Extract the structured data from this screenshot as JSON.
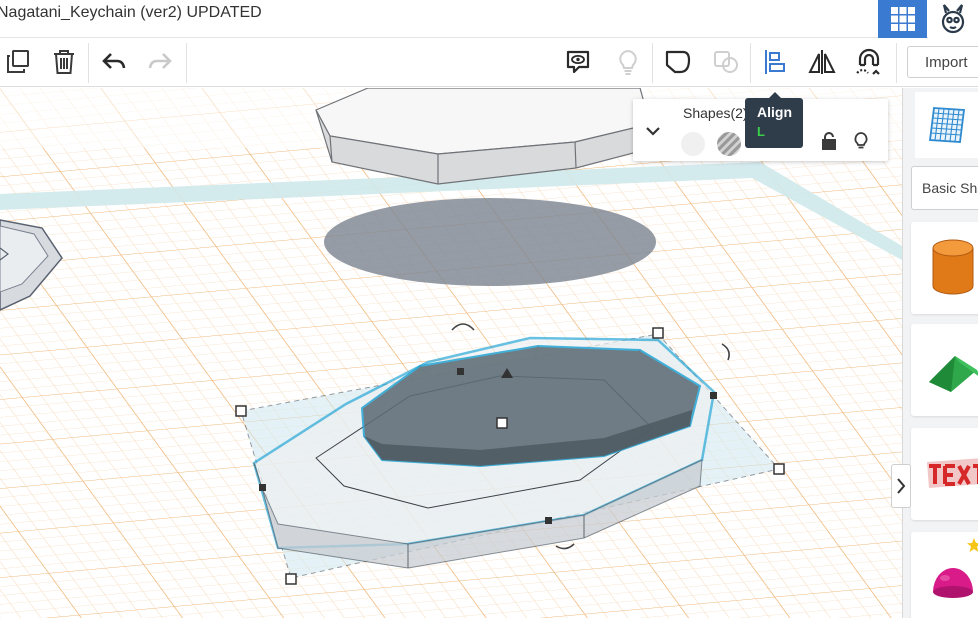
{
  "title_bar": {
    "project_title": "Nagatani_Keychain (ver2) UPDATED"
  },
  "toolbar": {
    "left_tools": [
      {
        "name": "copy-icon",
        "label": "Duplicate"
      },
      {
        "name": "trash-icon",
        "label": "Delete"
      },
      {
        "name": "undo-icon",
        "label": "Undo"
      },
      {
        "name": "redo-icon",
        "label": "Redo",
        "disabled": true
      }
    ],
    "right_tools": [
      {
        "name": "notes-icon"
      },
      {
        "name": "lightbulb-icon",
        "disabled": true
      },
      {
        "name": "group-icon"
      },
      {
        "name": "ungroup-icon",
        "disabled": true
      },
      {
        "name": "align-icon",
        "active": true
      },
      {
        "name": "mirror-icon"
      },
      {
        "name": "magnet-icon"
      }
    ],
    "import_label": "Import"
  },
  "inspector": {
    "title": "Shapes(2)",
    "solid_color": "#f0f0f0",
    "hole_pattern": "striped-grey"
  },
  "tooltip": {
    "title": "Align",
    "shortcut": "L"
  },
  "right_panel": {
    "category_label": "Basic Shapes",
    "shapes": [
      {
        "name": "cylinder",
        "color": "#e67e22"
      },
      {
        "name": "roof",
        "color": "#2ea84a"
      },
      {
        "name": "text",
        "color": "#d62828"
      },
      {
        "name": "half-sphere",
        "color": "#d91b8a"
      }
    ]
  },
  "colors": {
    "accent": "#3a7ad0",
    "selection_outline": "#29a7d6",
    "grid_line": "#f2c08a",
    "workplane_edge": "#bfe2e6",
    "tooltip_bg": "#2f3c4a"
  }
}
